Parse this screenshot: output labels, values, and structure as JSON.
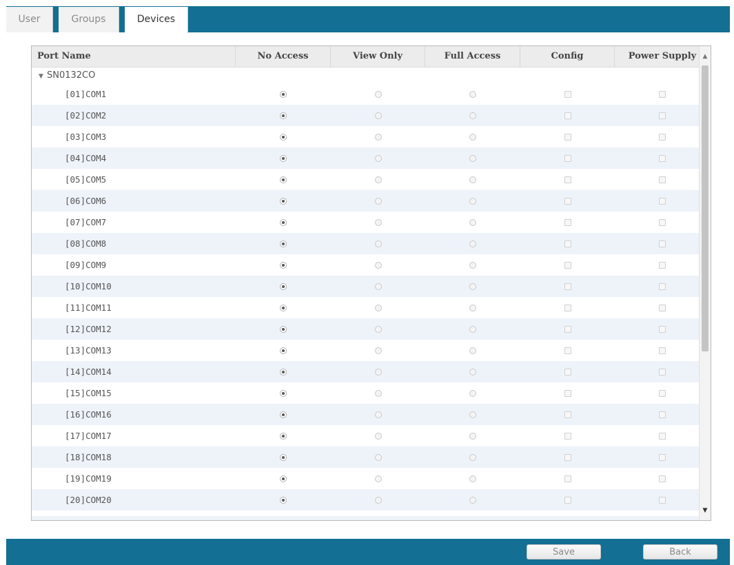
{
  "tabs": [
    {
      "label": "User",
      "active": false
    },
    {
      "label": "Groups",
      "active": false
    },
    {
      "label": "Devices",
      "active": true
    }
  ],
  "table": {
    "columns": [
      "Port Name",
      "No Access",
      "View Only",
      "Full Access",
      "Config",
      "Power Supply"
    ],
    "group": {
      "name": "SN0132CO",
      "expanded": true
    },
    "rows": [
      {
        "name": "[01]COM1",
        "access": "No Access",
        "config": false,
        "power_supply": false
      },
      {
        "name": "[02]COM2",
        "access": "No Access",
        "config": false,
        "power_supply": false
      },
      {
        "name": "[03]COM3",
        "access": "No Access",
        "config": false,
        "power_supply": false
      },
      {
        "name": "[04]COM4",
        "access": "No Access",
        "config": false,
        "power_supply": false
      },
      {
        "name": "[05]COM5",
        "access": "No Access",
        "config": false,
        "power_supply": false
      },
      {
        "name": "[06]COM6",
        "access": "No Access",
        "config": false,
        "power_supply": false
      },
      {
        "name": "[07]COM7",
        "access": "No Access",
        "config": false,
        "power_supply": false
      },
      {
        "name": "[08]COM8",
        "access": "No Access",
        "config": false,
        "power_supply": false
      },
      {
        "name": "[09]COM9",
        "access": "No Access",
        "config": false,
        "power_supply": false
      },
      {
        "name": "[10]COM10",
        "access": "No Access",
        "config": false,
        "power_supply": false
      },
      {
        "name": "[11]COM11",
        "access": "No Access",
        "config": false,
        "power_supply": false
      },
      {
        "name": "[12]COM12",
        "access": "No Access",
        "config": false,
        "power_supply": false
      },
      {
        "name": "[13]COM13",
        "access": "No Access",
        "config": false,
        "power_supply": false
      },
      {
        "name": "[14]COM14",
        "access": "No Access",
        "config": false,
        "power_supply": false
      },
      {
        "name": "[15]COM15",
        "access": "No Access",
        "config": false,
        "power_supply": false
      },
      {
        "name": "[16]COM16",
        "access": "No Access",
        "config": false,
        "power_supply": false
      },
      {
        "name": "[17]COM17",
        "access": "No Access",
        "config": false,
        "power_supply": false
      },
      {
        "name": "[18]COM18",
        "access": "No Access",
        "config": false,
        "power_supply": false
      },
      {
        "name": "[19]COM19",
        "access": "No Access",
        "config": false,
        "power_supply": false
      },
      {
        "name": "[20]COM20",
        "access": "No Access",
        "config": false,
        "power_supply": false
      }
    ]
  },
  "footer": {
    "save_label": "Save",
    "back_label": "Back"
  },
  "icons": {
    "group_caret": "triangle-down-icon",
    "scroll_up": "scroll-up-arrow-icon",
    "scroll_down": "scroll-down-arrow-icon"
  },
  "colors": {
    "bar": "#136f93",
    "row_alt": "#eef3fa",
    "header_bg": "#ececec"
  }
}
